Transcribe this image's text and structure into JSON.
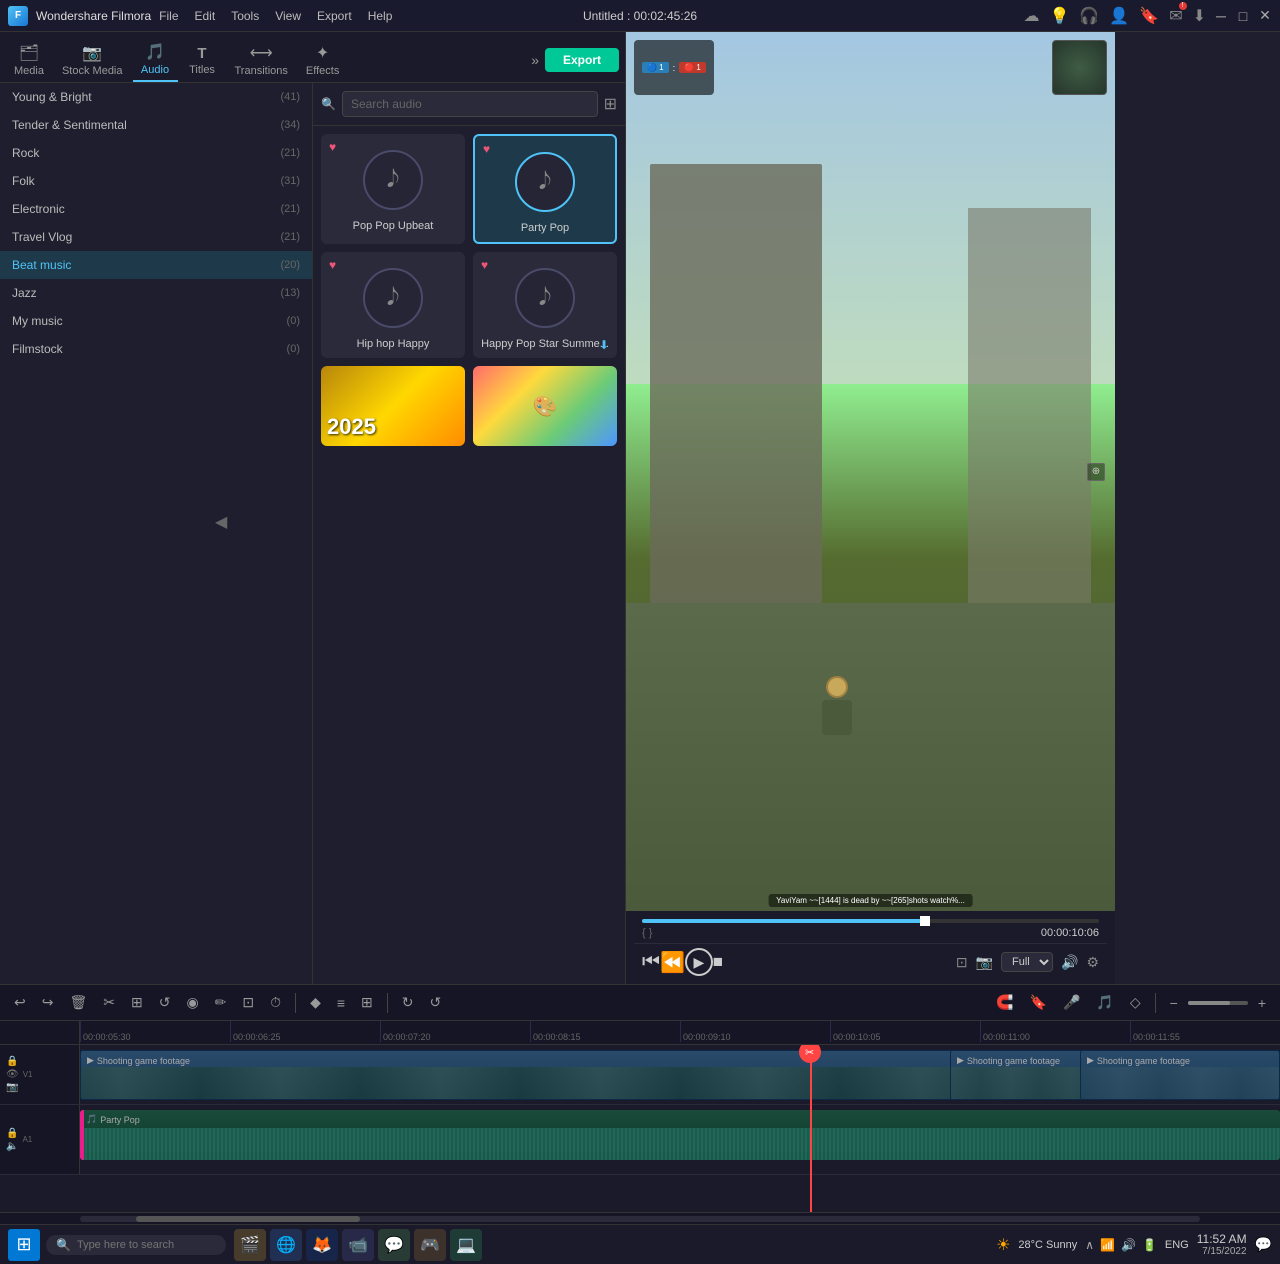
{
  "app": {
    "name": "Wondershare Filmora",
    "title": "Untitled : 00:02:45:26"
  },
  "menu": {
    "items": [
      "File",
      "Edit",
      "Tools",
      "View",
      "Export",
      "Help"
    ]
  },
  "window_controls": {
    "minimize": "─",
    "maximize": "□",
    "close": "✕"
  },
  "media_tabs": {
    "tabs": [
      {
        "id": "media",
        "label": "Media",
        "icon": "🗂"
      },
      {
        "id": "stock-media",
        "label": "Stock Media",
        "icon": "📷"
      },
      {
        "id": "audio",
        "label": "Audio",
        "icon": "🎵",
        "active": true
      },
      {
        "id": "titles",
        "label": "Titles",
        "icon": "T"
      },
      {
        "id": "transitions",
        "label": "Transitions",
        "icon": "⟷"
      },
      {
        "id": "effects",
        "label": "Effects",
        "icon": "✦"
      }
    ]
  },
  "categories": [
    {
      "name": "Young & Bright",
      "count": 41,
      "active": false
    },
    {
      "name": "Tender & Sentimental",
      "count": 34,
      "active": false
    },
    {
      "name": "Rock",
      "count": 21,
      "active": false
    },
    {
      "name": "Folk",
      "count": 31,
      "active": false
    },
    {
      "name": "Electronic",
      "count": 21,
      "active": false
    },
    {
      "name": "Travel Vlog",
      "count": 21,
      "active": false
    },
    {
      "name": "Beat music",
      "count": 20,
      "active": true
    },
    {
      "name": "Jazz",
      "count": 13,
      "active": false
    },
    {
      "name": "My music",
      "count": 0,
      "active": false
    },
    {
      "name": "Filmstock",
      "count": 0,
      "active": false
    }
  ],
  "search": {
    "placeholder": "Search audio"
  },
  "audio_cards": [
    {
      "id": "pop-pop",
      "name": "Pop Pop Upbeat",
      "selected": false,
      "has_heart": true
    },
    {
      "id": "party-pop",
      "name": "Party Pop",
      "selected": true,
      "has_heart": true
    },
    {
      "id": "hip-hop",
      "name": "Hip hop Happy",
      "selected": false,
      "has_heart": true
    },
    {
      "id": "happy-pop",
      "name": "Happy Pop Star Summe...",
      "selected": false,
      "has_heart": true,
      "has_download": true
    }
  ],
  "export_btn": "Export",
  "preview": {
    "time_current": "00:00:10:06",
    "progress_pct": 62,
    "quality": "Full"
  },
  "timeline": {
    "ruler_marks": [
      "00:00:05:30",
      "00:00:06:25",
      "00:00:07:20",
      "00:00:08:15",
      "00:00:09:10",
      "00:00:10:05",
      "00:00:11:00",
      "00:00:11:55"
    ],
    "tracks": [
      {
        "type": "video",
        "label": "Shooting game footage",
        "icon": "🎬"
      },
      {
        "type": "audio",
        "label": "Party Pop",
        "icon": "🎵"
      }
    ]
  },
  "taskbar": {
    "search_placeholder": "Type here to search",
    "weather": "28°C  Sunny",
    "time": "11:52 AM",
    "date": "7/15/2022",
    "language": "ENG"
  },
  "toolbar_icons": [
    "↩",
    "↪",
    "🗑",
    "✂",
    "⊞",
    "↺",
    "◎",
    "✏",
    "⊡",
    "⏱",
    "◆",
    "≡",
    "⊞",
    "↻",
    "↺"
  ]
}
